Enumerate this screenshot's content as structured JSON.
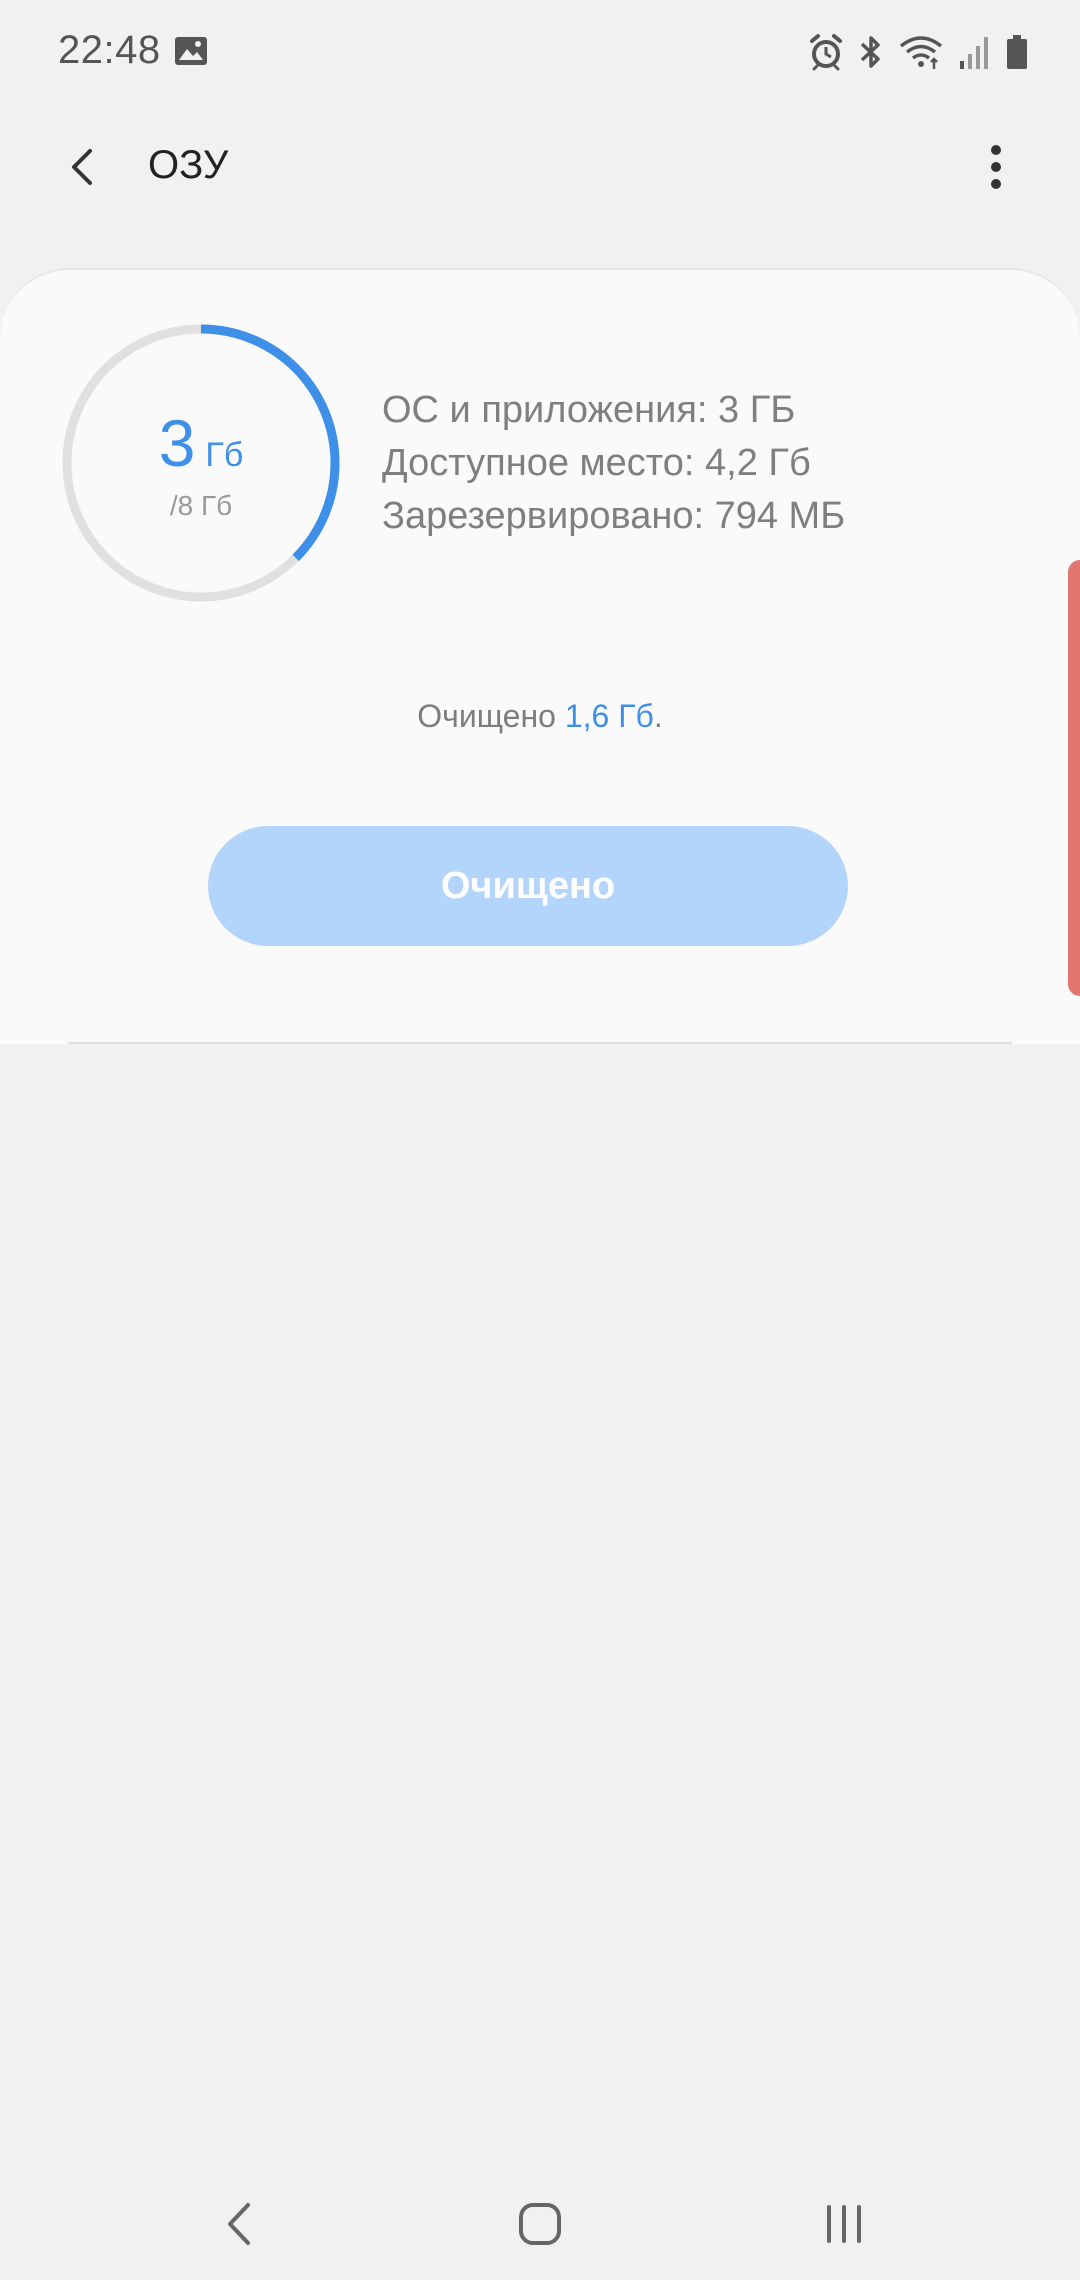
{
  "status_bar": {
    "time": "22:48",
    "icons": [
      "gallery-icon",
      "alarm-icon",
      "bluetooth-icon",
      "wifi-icon",
      "signal-icon",
      "battery-icon"
    ]
  },
  "app_bar": {
    "title": "ОЗУ",
    "back_icon": "chevron-left-icon",
    "more_icon": "more-vert-icon"
  },
  "memory": {
    "used_value": "3",
    "used_unit": "Гб",
    "total": "/8 Гб",
    "used_fraction": 0.375,
    "info": [
      "ОС и приложения: 3 ГБ",
      "Доступное место: 4,2 Гб",
      "Зарезервировано: 794 МБ"
    ],
    "freed_prefix": "Очищено ",
    "freed_value": "1,6 Гб",
    "freed_suffix": ".",
    "clean_button": "Очищено"
  },
  "colors": {
    "accent": "#3d8fe8",
    "button_disabled": "#b3d4fb",
    "gauge_track": "#e0e0e0",
    "edge_handle": "#e3756f"
  },
  "nav_bar": {
    "icons": [
      "nav-back-icon",
      "home-icon",
      "recents-icon"
    ]
  }
}
